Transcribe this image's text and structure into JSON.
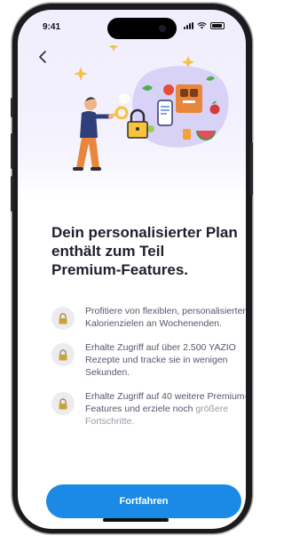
{
  "status_bar": {
    "time": "9:41"
  },
  "header": {
    "back_icon": "chevron-left-icon"
  },
  "hero": {
    "illustration": "person-with-key-unlocking-premium"
  },
  "title": "Dein personalisierter Plan enthält zum Teil Premium-Features.",
  "features": [
    {
      "icon": "lock-icon",
      "text": "Profitiere von flexiblen, personalisierten Kalorienzielen an Wochenenden.",
      "faded": ""
    },
    {
      "icon": "lock-icon",
      "text": "Erhalte Zugriff auf über 2.500 YAZIO Rezepte und tracke sie in wenigen Sekunden.",
      "faded": ""
    },
    {
      "icon": "lock-icon",
      "text": "Erhalte Zugriff auf 40 weitere Premium-Features und erziele noch",
      "faded": "größere Fortschritte."
    }
  ],
  "cta": {
    "label": "Fortfahren"
  },
  "colors": {
    "accent": "#1a8ae6",
    "lock": "#c9a23b",
    "title": "#1f1f2e"
  }
}
